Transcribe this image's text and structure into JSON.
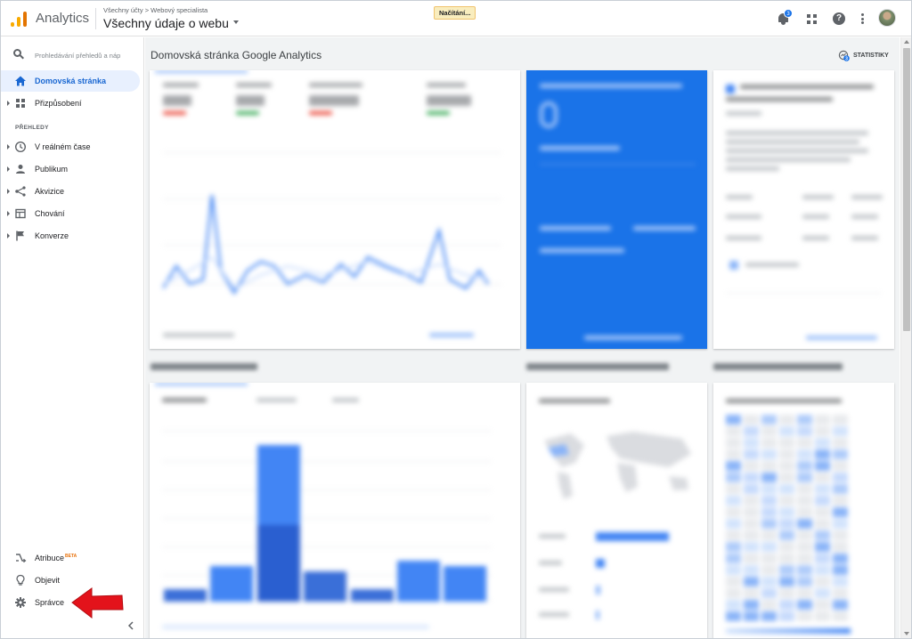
{
  "header": {
    "app_title": "Analytics",
    "breadcrumb": "Všechny účty > Webový specialista",
    "view_name": "Všechny údaje o webu",
    "loading_label": "Načítání...",
    "notifications_count": "3",
    "help_label": "?",
    "icons": [
      "analytics-logo-icon",
      "bell-icon",
      "apps-grid-icon",
      "help-icon",
      "more-vert-icon",
      "avatar"
    ]
  },
  "sidebar": {
    "search_placeholder": "Prohledávání přehledů a náp",
    "home_label": "Domovská stránka",
    "customize_label": "Přizpůsobení",
    "section_reports": "PŘEHLEDY",
    "reports": [
      {
        "label": "V reálném čase",
        "icon": "clock-icon"
      },
      {
        "label": "Publikum",
        "icon": "person-icon"
      },
      {
        "label": "Akvizice",
        "icon": "acquisition-icon"
      },
      {
        "label": "Chování",
        "icon": "behavior-icon"
      },
      {
        "label": "Konverze",
        "icon": "flag-icon"
      }
    ],
    "bottom": [
      {
        "label": "Atribuce",
        "badge": "BETA",
        "icon": "attribution-icon"
      },
      {
        "label": "Objevit",
        "icon": "lightbulb-icon"
      },
      {
        "label": "Správce",
        "icon": "gear-icon"
      }
    ]
  },
  "main": {
    "page_title": "Domovská stránka Google Analytics",
    "stats_label": "STATISTIKY",
    "stats_badge": "3"
  },
  "colors": {
    "accent_blue": "#1a73e8",
    "active_nav_bg": "#e8f0fe",
    "active_nav_text": "#1967d2",
    "arrow_red": "#e3131b",
    "beta_orange": "#e8710a"
  }
}
